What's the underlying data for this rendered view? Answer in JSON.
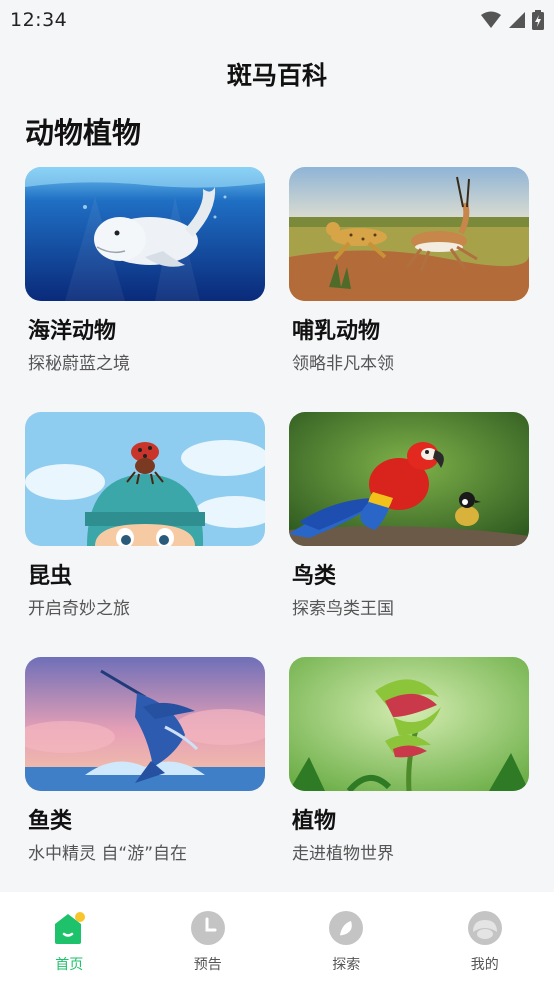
{
  "status": {
    "time": "12:34"
  },
  "app": {
    "title": "斑马百科"
  },
  "section": {
    "title": "动物植物"
  },
  "cards": [
    {
      "title": "海洋动物",
      "subtitle": "探秘蔚蓝之境",
      "image": "beluga-whale-underwater"
    },
    {
      "title": "哺乳动物",
      "subtitle": "领略非凡本领",
      "image": "cheetah-chasing-gazelle"
    },
    {
      "title": "昆虫",
      "subtitle": "开启奇妙之旅",
      "image": "ladybug-on-boy-head"
    },
    {
      "title": "鸟类",
      "subtitle": "探索鸟类王国",
      "image": "macaw-and-small-bird"
    },
    {
      "title": "鱼类",
      "subtitle": "水中精灵 自“游”自在",
      "image": "marlin-leaping-sunset"
    },
    {
      "title": "植物",
      "subtitle": "走进植物世界",
      "image": "venus-flytrap"
    }
  ],
  "nav": {
    "items": [
      {
        "label": "首页",
        "icon": "home-icon",
        "active": true
      },
      {
        "label": "预告",
        "icon": "clock-icon",
        "active": false
      },
      {
        "label": "探索",
        "icon": "compass-icon",
        "active": false
      },
      {
        "label": "我的",
        "icon": "profile-icon",
        "active": false
      }
    ]
  },
  "colors": {
    "accent": "#1ec26a",
    "background": "#f5f6f8",
    "nav_inactive": "#c4c4c4"
  }
}
